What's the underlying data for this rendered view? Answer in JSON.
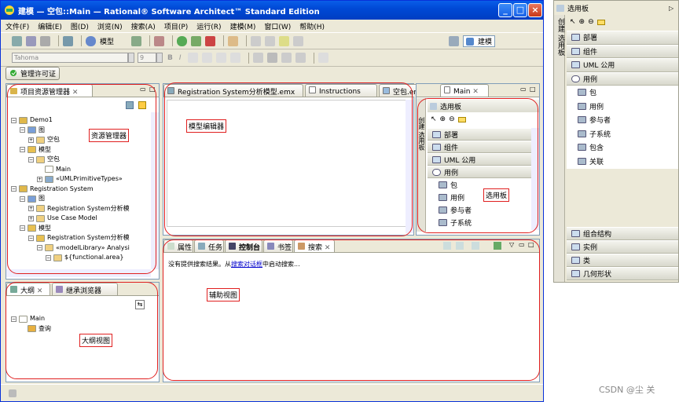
{
  "window": {
    "title": "建模 — 空包::Main — Rational® Software Architect™ Standard Edition",
    "minimize": "_",
    "maximize": "□",
    "close": "×"
  },
  "menubar": [
    "文件(F)",
    "编辑(E)",
    "图(D)",
    "浏览(N)",
    "搜索(A)",
    "项目(P)",
    "运行(R)",
    "建模(M)",
    "窗口(W)",
    "帮助(H)"
  ],
  "toolbar": {
    "model_label": "模型",
    "perspective_label": "建模",
    "font_value": "Tahoma",
    "size_value": "9",
    "license_label": "管理许可证"
  },
  "explorer": {
    "tab": "项目资源管理器",
    "tree": [
      {
        "label": "Demo1",
        "level": 0,
        "toggle": "−",
        "icon": "project"
      },
      {
        "label": "图",
        "level": 1,
        "toggle": "−",
        "icon": "diagram"
      },
      {
        "label": "空包",
        "level": 2,
        "toggle": "+",
        "icon": "package"
      },
      {
        "label": "模型",
        "level": 1,
        "toggle": "−",
        "icon": "model"
      },
      {
        "label": "空包",
        "level": 2,
        "toggle": "−",
        "icon": "package"
      },
      {
        "label": "Main",
        "level": 3,
        "toggle": "",
        "icon": "file"
      },
      {
        "label": "«UMLPrimitiveTypes»",
        "level": 3,
        "toggle": "+",
        "icon": "lib"
      },
      {
        "label": "Registration System",
        "level": 0,
        "toggle": "−",
        "icon": "project"
      },
      {
        "label": "图",
        "level": 1,
        "toggle": "−",
        "icon": "diagram"
      },
      {
        "label": "Registration System分析模",
        "level": 2,
        "toggle": "+",
        "icon": "package"
      },
      {
        "label": "Use Case Model",
        "level": 2,
        "toggle": "+",
        "icon": "package"
      },
      {
        "label": "模型",
        "level": 1,
        "toggle": "−",
        "icon": "model"
      },
      {
        "label": "Registration System分析模",
        "level": 2,
        "toggle": "−",
        "icon": "model"
      },
      {
        "label": "«modelLibrary» Analysi",
        "level": 3,
        "toggle": "−",
        "icon": "package"
      },
      {
        "label": "${functional.area}",
        "level": 4,
        "toggle": "−",
        "icon": "package"
      }
    ],
    "annotation": "资源管理器"
  },
  "editor": {
    "tabs": [
      "Registration System分析模型.emx",
      "Instructions",
      "空包.emx",
      "Main"
    ],
    "annotation": "模型编辑器"
  },
  "palette_inner": {
    "title": "选用板",
    "side_label": "创建 选用板",
    "rows": [
      {
        "label": "部署",
        "type": "header"
      },
      {
        "label": "组件",
        "type": "header"
      },
      {
        "label": "UML 公用",
        "type": "header"
      },
      {
        "label": "用例",
        "type": "header-open"
      },
      {
        "label": "包",
        "type": "item"
      },
      {
        "label": "用例",
        "type": "item"
      },
      {
        "label": "参与者",
        "type": "item"
      },
      {
        "label": "子系统",
        "type": "item"
      }
    ],
    "annotation": "选用板"
  },
  "outline": {
    "tabs": [
      "大纲",
      "继承浏览器"
    ],
    "tree": [
      {
        "label": "Main",
        "level": 0,
        "toggle": "−",
        "icon": "file"
      },
      {
        "label": "查询",
        "level": 1,
        "toggle": "",
        "icon": "query"
      }
    ],
    "annotation": "大纲视图"
  },
  "aux": {
    "tabs": [
      "属性",
      "任务",
      "控制台",
      "书签",
      "搜索"
    ],
    "message_prefix": "没有提供搜索结果。从",
    "message_link": "搜索对话框",
    "message_suffix": "中启动搜索...",
    "annotation": "辅助视图"
  },
  "palette_outer": {
    "title": "选用板",
    "side_label": "创建 选用板",
    "rows": [
      {
        "label": "部署",
        "type": "header"
      },
      {
        "label": "组件",
        "type": "header"
      },
      {
        "label": "UML 公用",
        "type": "header"
      },
      {
        "label": "用例",
        "type": "header-open"
      },
      {
        "label": "包",
        "type": "item"
      },
      {
        "label": "用例",
        "type": "item"
      },
      {
        "label": "参与者",
        "type": "item"
      },
      {
        "label": "子系统",
        "type": "item"
      },
      {
        "label": "包含",
        "type": "item"
      },
      {
        "label": "关联",
        "type": "item"
      }
    ],
    "bottom_rows": [
      "组合结构",
      "实例",
      "类",
      "几何形状"
    ]
  },
  "watermark": "CSDN @尘 关",
  "colors": {
    "title_blue": "#0a5ee8",
    "annotation_red": "#e02020",
    "link_blue": "#0000cc"
  }
}
